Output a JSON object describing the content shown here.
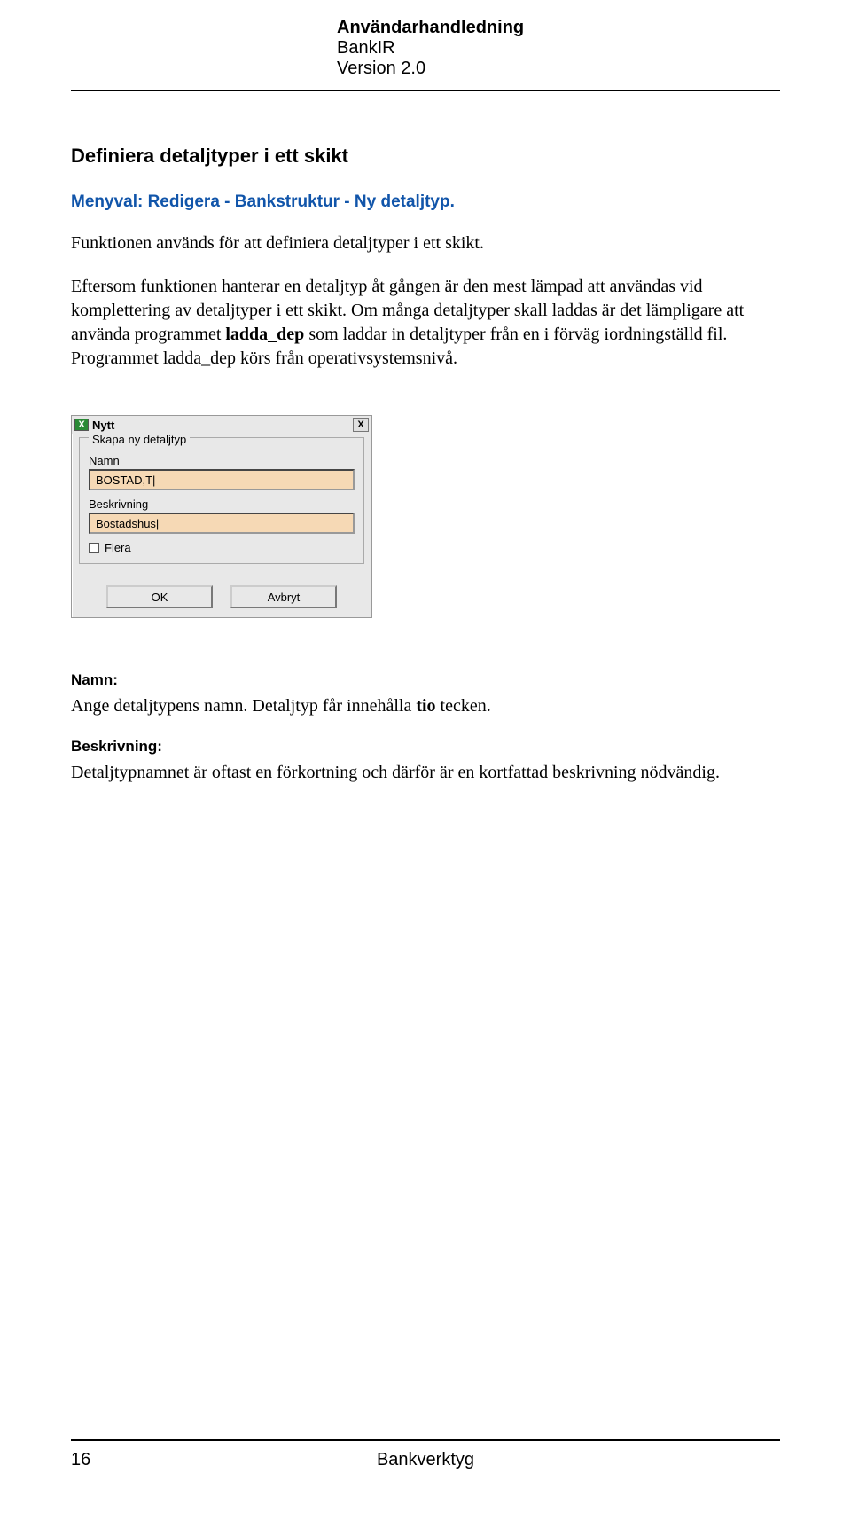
{
  "header": {
    "title": "Användarhandledning",
    "line2": "BankIR",
    "line3": "Version 2.0"
  },
  "section_heading": "Definiera detaljtyper i ett skikt",
  "menu_line": "Menyval: Redigera - Bankstruktur - Ny detaljtyp.",
  "para1": "Funktionen används för att definiera detaljtyper i ett skikt.",
  "para2_a": "Eftersom funktionen hanterar en detaljtyp åt gången är den mest lämpad att användas vid komplettering av detaljtyper i ett skikt. Om många detaljtyper skall laddas är det lämpligare att använda programmet ",
  "para2_bold": "ladda_dep",
  "para2_b": " som laddar in detaljtyper från en i förväg iordningställd fil. Programmet ladda_dep körs från operativsystemsnivå.",
  "dialog": {
    "icon_letter": "X",
    "title": "Nytt",
    "close": "X",
    "legend": "Skapa ny detaljtyp",
    "name_label": "Namn",
    "name_value": "BOSTAD,T|",
    "desc_label": "Beskrivning",
    "desc_value": "Bostadshus|",
    "checkbox_label": "Flera",
    "ok": "OK",
    "cancel": "Avbryt"
  },
  "fields": {
    "namn_label": "Namn:",
    "namn_text_a": "Ange detaljtypens namn. Detaljtyp får innehålla ",
    "namn_text_bold": "tio",
    "namn_text_b": " tecken.",
    "beskr_label": "Beskrivning:",
    "beskr_text": "Detaljtypnamnet är oftast en förkortning och därför är en kortfattad beskrivning nödvändig."
  },
  "footer": {
    "page": "16",
    "section": "Bankverktyg"
  }
}
